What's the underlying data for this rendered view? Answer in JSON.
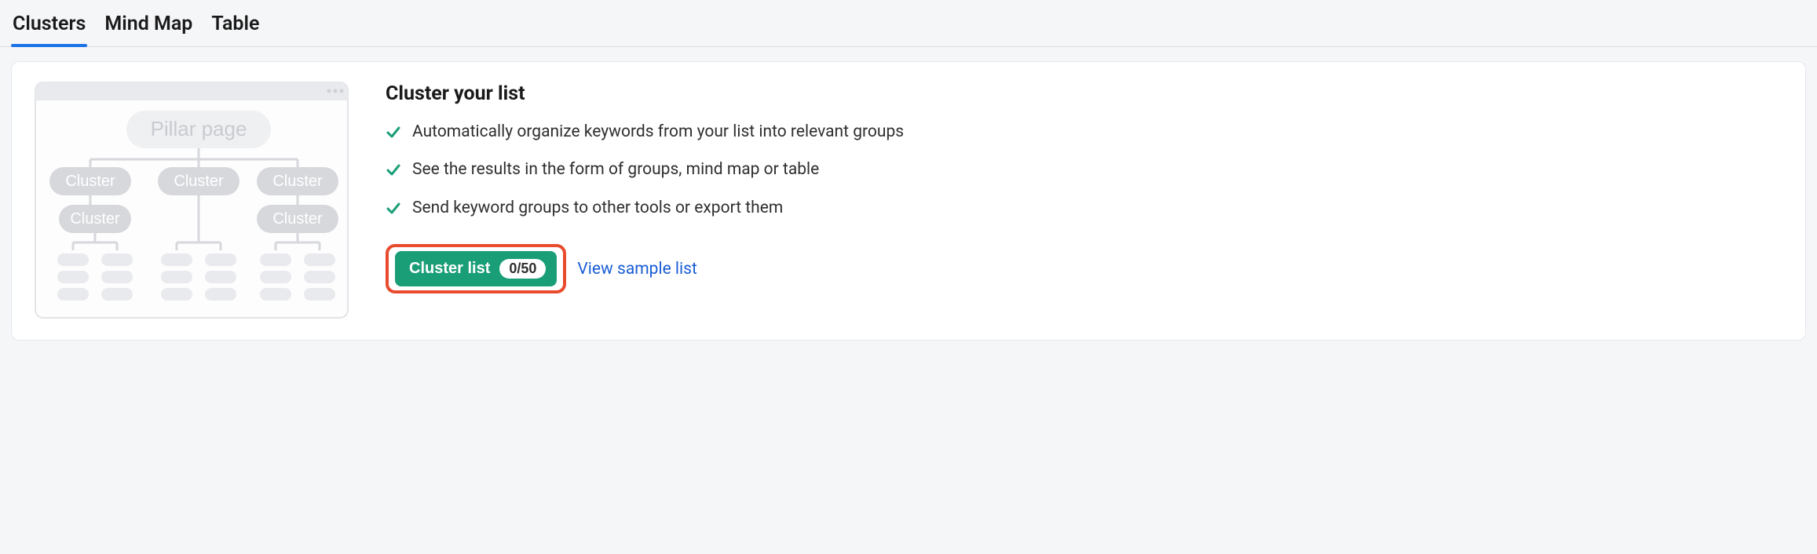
{
  "tabs": {
    "clusters": "Clusters",
    "mind_map": "Mind Map",
    "table": "Table"
  },
  "main": {
    "title": "Cluster your list",
    "features": {
      "f1": "Automatically organize keywords from your list into relevant groups",
      "f2": "See the results in the form of groups, mind map or table",
      "f3": "Send keyword groups to other tools or export them"
    },
    "cluster_button": {
      "label": "Cluster list",
      "counter": "0/50"
    },
    "sample_link": "View sample list"
  },
  "illustration": {
    "pillar_label": "Pillar page",
    "node_label": "Cluster"
  }
}
